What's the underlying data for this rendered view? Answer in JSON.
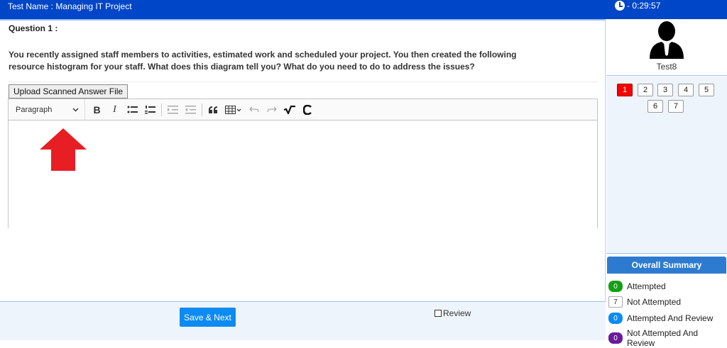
{
  "header": {
    "title": "Test Name : Managing IT Project",
    "timer": "- 0:29:57"
  },
  "question": {
    "number_label": "Question 1 :",
    "text": "You recently assigned staff members to activities, estimated work and scheduled your project. You then created the following resource histogram for your staff. What does this diagram tell you? What do you need to do to address the issues?"
  },
  "upload_label": "Upload Scanned Answer File",
  "editor": {
    "paragraph_label": "Paragraph",
    "tools": {
      "bold": "B",
      "italic": "I"
    }
  },
  "colors": {
    "accent": "#0046c8",
    "save": "#0d8bf2",
    "current": "#f50000",
    "attempted": "#14a014",
    "review": "#0d8bf2",
    "not_attempted_review": "#6a1b9a",
    "arrow": "#e81e25"
  },
  "footer": {
    "save_label": "Save & Next",
    "review_label": "Review"
  },
  "user": {
    "name": "Test8"
  },
  "palette": [
    "1",
    "2",
    "3",
    "4",
    "5",
    "6",
    "7"
  ],
  "summary": {
    "title": "Overall Summary",
    "items": [
      {
        "count": "0",
        "label": "Attempted"
      },
      {
        "count": "7",
        "label": "Not Attempted"
      },
      {
        "count": "0",
        "label": "Attempted And Review"
      },
      {
        "count": "0",
        "label": "Not Attempted And Review"
      }
    ]
  }
}
